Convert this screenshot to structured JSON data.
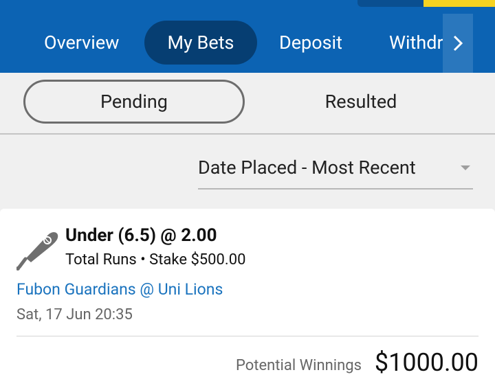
{
  "colors": {
    "brand_blue": "#0c63b3",
    "active_tab": "#063e72",
    "link_blue": "#1a73be",
    "accent_yellow": "#f6d221"
  },
  "nav": {
    "tabs": [
      {
        "label": "Overview"
      },
      {
        "label": "My Bets",
        "active": true
      },
      {
        "label": "Deposit"
      },
      {
        "label": "Withdraw"
      }
    ],
    "scroll_icon": "chevron-right-icon"
  },
  "segments": {
    "pending": "Pending",
    "resulted": "Resulted",
    "selected": "Pending"
  },
  "sort": {
    "value": "Date Placed - Most Recent"
  },
  "bet": {
    "icon": "baseball-bat-icon",
    "selection": "Under (6.5) @ 2.00",
    "market": "Total Runs",
    "separator": "•",
    "stake": "Stake $500.00",
    "event": "Fubon Guardians @ Uni Lions",
    "datetime": "Sat, 17 Jun 20:35",
    "potential_label": "Potential Winnings",
    "potential_value": "$1000.00"
  }
}
